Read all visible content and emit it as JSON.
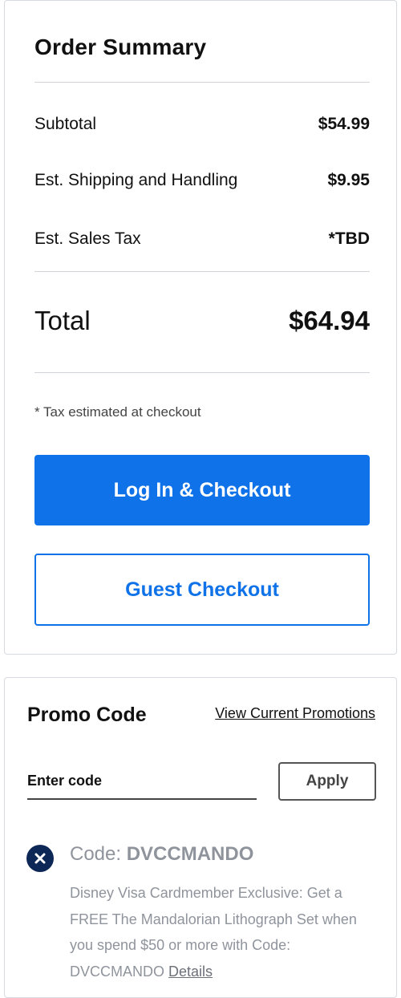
{
  "order_summary": {
    "title": "Order Summary",
    "rows": [
      {
        "label": "Subtotal",
        "value": "$54.99"
      },
      {
        "label": "Est. Shipping and Handling",
        "value": "$9.95"
      },
      {
        "label": "Est. Sales Tax",
        "value": "*TBD"
      }
    ],
    "total": {
      "label": "Total",
      "value": "$64.94"
    },
    "tax_note": "* Tax estimated at checkout",
    "login_checkout_label": "Log In & Checkout",
    "guest_checkout_label": "Guest Checkout"
  },
  "promo": {
    "title": "Promo Code",
    "view_promotions_label": "View Current Promotions",
    "input_placeholder": "Enter code",
    "apply_label": "Apply",
    "applied_code": {
      "label": "Code:",
      "code": "DVCCMANDO",
      "description": "Disney Visa Cardmember Exclusive: Get a FREE The Mandalorian Lithograph Set when you spend $50 or more with Code: DVCCMANDO",
      "details_label": "Details"
    }
  },
  "colors": {
    "primary": "#1072e8",
    "icon_navy": "#0d2856",
    "muted_text": "#8f949c"
  },
  "icons": {
    "remove_code": "close-circle-icon"
  }
}
